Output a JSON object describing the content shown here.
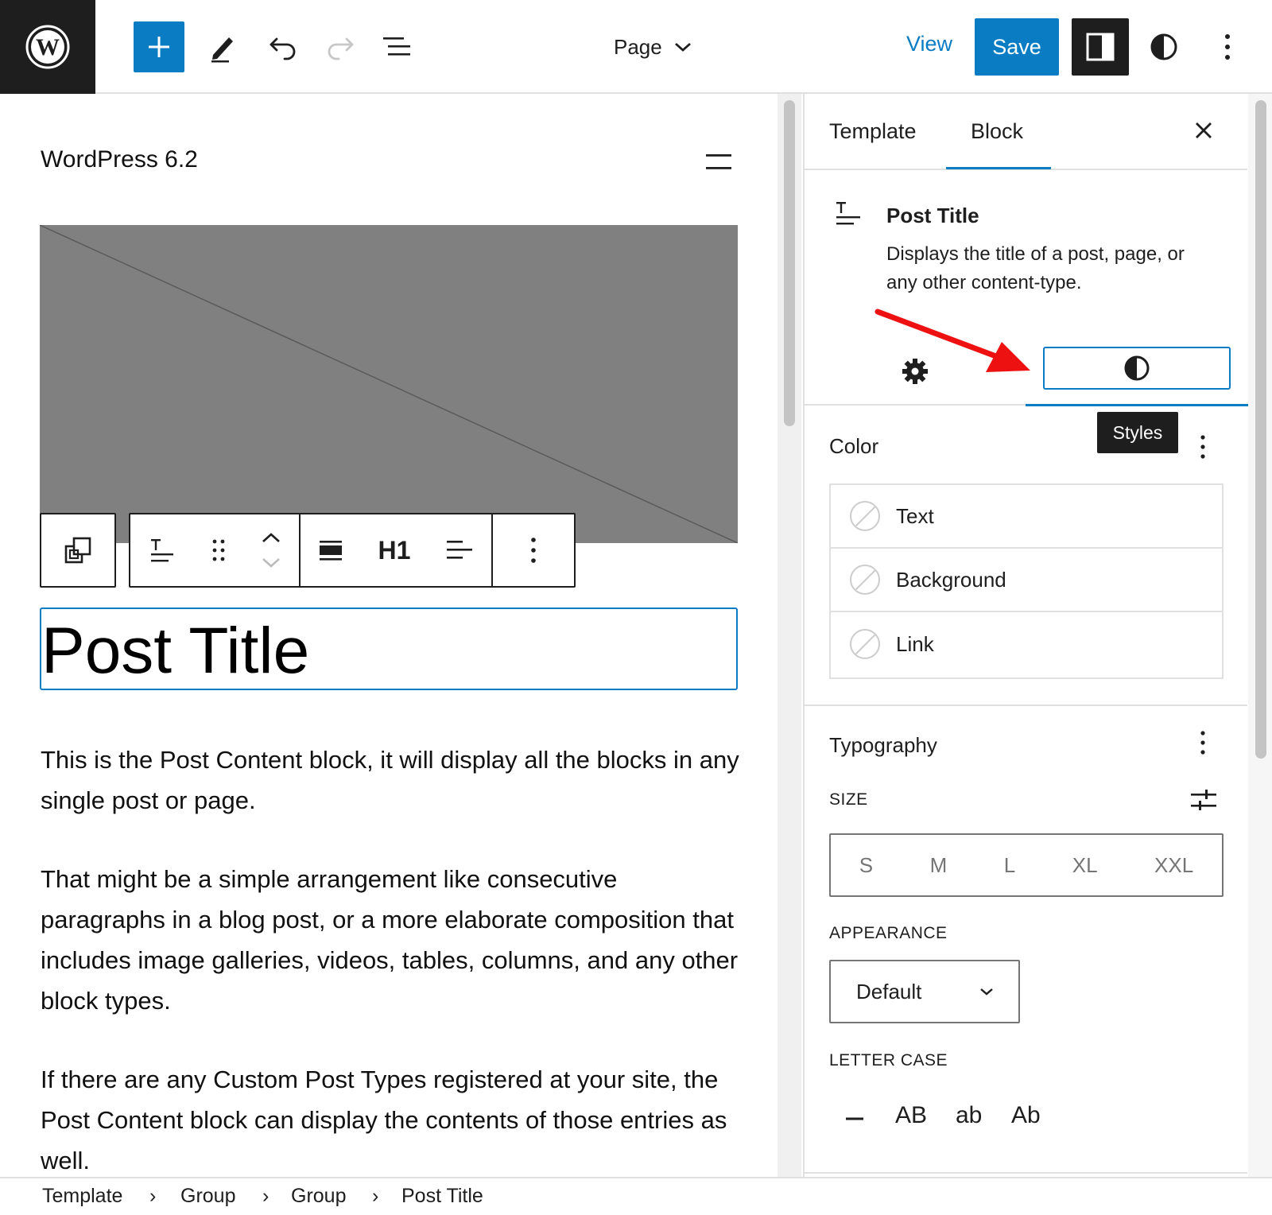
{
  "topbar": {
    "document_title": "Page",
    "view_label": "View",
    "save_label": "Save"
  },
  "canvas": {
    "site_title": "WordPress 6.2",
    "heading_level": "H1",
    "post_title": "Post Title",
    "paragraphs": [
      "This is the Post Content block, it will display all the blocks in any single post or page.",
      "That might be a simple arrangement like consecutive paragraphs in a blog post, or a more elaborate composition that includes image galleries, videos, tables, columns, and any other block types.",
      "If there are any Custom Post Types registered at your site, the Post Content block can display the contents of those entries as well."
    ]
  },
  "sidebar": {
    "tabs": [
      {
        "label": "Template"
      },
      {
        "label": "Block"
      }
    ],
    "block_card": {
      "title": "Post Title",
      "description": "Displays the title of a post, page, or any other content-type."
    },
    "styles_tooltip": "Styles",
    "color": {
      "title": "Color",
      "items": [
        {
          "label": "Text"
        },
        {
          "label": "Background"
        },
        {
          "label": "Link"
        }
      ]
    },
    "typography": {
      "title": "Typography",
      "size_label": "SIZE",
      "sizes": [
        "S",
        "M",
        "L",
        "XL",
        "XXL"
      ],
      "appearance_label": "APPEARANCE",
      "appearance_value": "Default",
      "letter_case_label": "LETTER CASE",
      "letter_case_options": [
        "AB",
        "ab",
        "Ab"
      ]
    }
  },
  "breadcrumb": [
    "Template",
    "Group",
    "Group",
    "Post Title"
  ],
  "colors": {
    "accent": "#0a7cc4",
    "dark": "#1e1e1e",
    "placeholder_image": "#808080",
    "annotation_arrow": "#ee1111"
  }
}
